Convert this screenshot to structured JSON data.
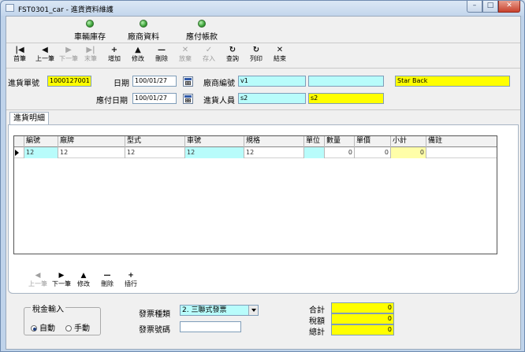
{
  "window": {
    "title": "FST0301_car - 進貨資料維護"
  },
  "modules": [
    {
      "label": "車輛庫存"
    },
    {
      "label": "廠商資料"
    },
    {
      "label": "應付帳款"
    }
  ],
  "toolbar": {
    "first": "首筆",
    "prev": "上一筆",
    "next": "下一筆",
    "last": "末筆",
    "add": "增加",
    "edit": "修改",
    "delete": "刪除",
    "cancel": "放棄",
    "save": "存入",
    "query": "查詢",
    "print": "列印",
    "exit": "結束"
  },
  "header": {
    "purchase_no_label": "進貨單號",
    "purchase_no": "1000127001",
    "date_label": "日期",
    "date": "100/01/27",
    "vendor_no_label": "廠商編號",
    "vendor_no": "v1",
    "vendor_extra": "",
    "vendor_name": "Star Back",
    "due_date_label": "應付日期",
    "due_date": "100/01/27",
    "buyer_label": "進貨人員",
    "buyer_code": "s2",
    "buyer_name": "s2"
  },
  "tabs": {
    "detail": "進貨明細"
  },
  "grid": {
    "columns": [
      "編號",
      "廠牌",
      "型式",
      "車號",
      "規格",
      "單位",
      "數量",
      "單價",
      "小計",
      "備註"
    ],
    "rows": [
      [
        "12",
        "12",
        "12",
        "12",
        "12",
        "",
        "0",
        "0",
        "0",
        ""
      ]
    ]
  },
  "subtoolbar": {
    "prev": "上一筆",
    "next": "下一筆",
    "edit": "修改",
    "delete": "刪除",
    "insert": "插行"
  },
  "footer": {
    "tax_label": "稅金輸入",
    "auto_label": "自動",
    "manual_label": "手動",
    "invoice_type_label": "發票種類",
    "invoice_type": "2. 三聯式發票",
    "invoice_no_label": "發票號碼",
    "invoice_no": "",
    "subtotal_label": "合計",
    "subtotal": "0",
    "tax_amount_label": "稅額",
    "tax_amount": "0",
    "total_label": "總計",
    "total": "0"
  }
}
